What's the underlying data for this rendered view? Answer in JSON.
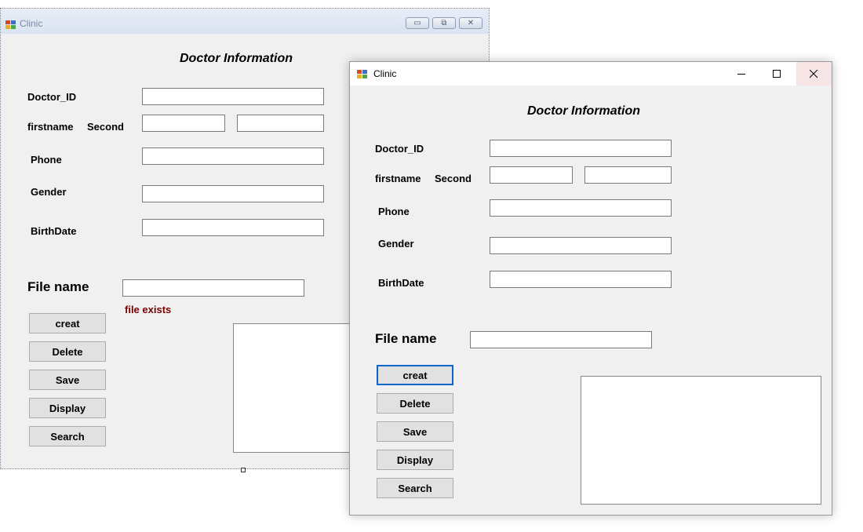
{
  "designer_window": {
    "title": "Clinic",
    "icon": "form-app-icon",
    "form_title": "Doctor Information",
    "labels": {
      "doctor_id": "Doctor_ID",
      "firstname": "firstname",
      "second": "Second",
      "phone": "Phone",
      "gender": "Gender",
      "birthdate": "BirthDate",
      "file_name": "File name"
    },
    "error_text": "file exists",
    "buttons": [
      "creat",
      "Delete",
      "Save",
      "Display",
      "Search"
    ]
  },
  "runtime_window": {
    "title": "Clinic",
    "icon": "form-app-icon",
    "form_title": "Doctor Information",
    "labels": {
      "doctor_id": "Doctor_ID",
      "firstname": "firstname",
      "second": "Second",
      "phone": "Phone",
      "gender": "Gender",
      "birthdate": "BirthDate",
      "file_name": "File name"
    },
    "buttons": [
      "creat",
      "Delete",
      "Save",
      "Display",
      "Search"
    ],
    "focused_button": "creat"
  },
  "colors": {
    "error_text": "#7a0000",
    "focus_border": "#0a64c8",
    "form_background": "#f0f0f0"
  }
}
